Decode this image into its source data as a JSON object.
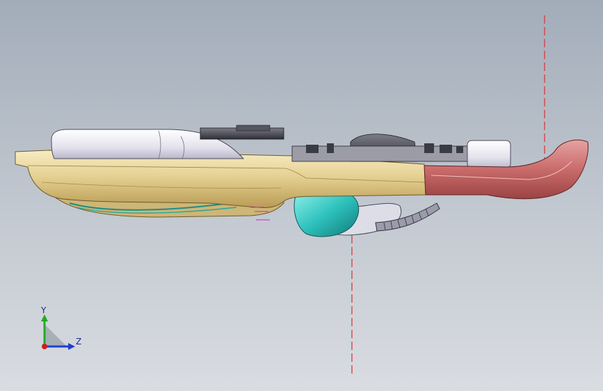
{
  "viewport": {
    "background_top": "#a2acb9",
    "background_bottom": "#d9dce1"
  },
  "triad": {
    "y_axis_label": "Y",
    "z_axis_label": "Z",
    "y_color": "#22aa22",
    "z_color": "#1f3fcf",
    "x_color": "#d11e1e",
    "icon": "view-orientation-triad-icon"
  },
  "model": {
    "shell_color": "#e8d59a",
    "head_color": "#c76a6a",
    "battery_color": "#eceaf4",
    "teal_color": "#2ec2bd",
    "centerline_color": "#d63a3a"
  }
}
